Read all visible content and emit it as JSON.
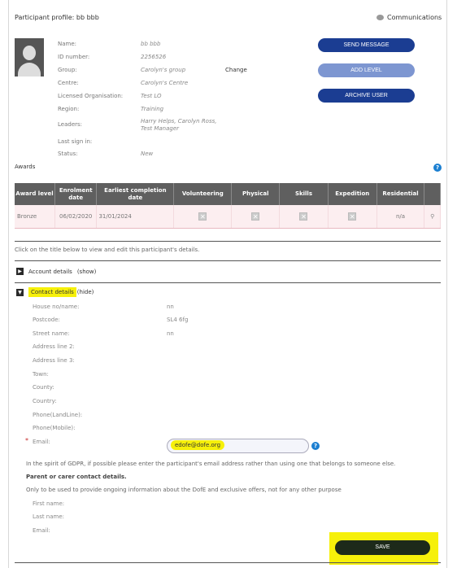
{
  "header": {
    "title": "Participant profile: bb bbb",
    "communications_label": "Communications",
    "communications_icon": "speech-bubble-icon"
  },
  "profile": {
    "fields": [
      {
        "label": "Name:",
        "value": "bb bbb"
      },
      {
        "label": "ID number:",
        "value": "2256526"
      },
      {
        "label": "Group:",
        "value": "Carolyn's group"
      },
      {
        "label": "Centre:",
        "value": "Carolyn's Centre"
      },
      {
        "label": "Licensed Organisation:",
        "value": "Test LO"
      },
      {
        "label": "Region:",
        "value": "Training"
      },
      {
        "label": "Leaders:",
        "value": "Harry Helps, Carolyn Ross, Test Manager"
      },
      {
        "label": "Last sign in:",
        "value": ""
      },
      {
        "label": "Status:",
        "value": "New"
      }
    ],
    "change_label": "Change",
    "avatar_icon": "user-silhouette-icon"
  },
  "actions": {
    "send_message": "SEND MESSAGE",
    "add_level": "ADD LEVEL",
    "archive_user": "ARCHIVE USER"
  },
  "awards": {
    "title": "Awards",
    "help": "?",
    "columns": [
      "Award level",
      "Enrolment date",
      "Earliest completion date",
      "Volunteering",
      "Physical",
      "Skills",
      "Expedition",
      "Residential",
      ""
    ],
    "rows": [
      {
        "level": "Bronze",
        "enrolment": "06/02/2020",
        "earliest": "31/01/2024",
        "residential": "n/a"
      }
    ],
    "search_icon": "magnifier-icon"
  },
  "info_text": "Click on the title below to view and edit this participant's details.",
  "sections": {
    "account": {
      "title": "Account details",
      "toggle": "(show)"
    },
    "contact": {
      "title": "Contact details",
      "toggle": "(hide)"
    }
  },
  "contact": {
    "fields": [
      {
        "label": "House no/name:",
        "value": "nn"
      },
      {
        "label": "Postcode:",
        "value": "SL4 6fg"
      },
      {
        "label": "Street name:",
        "value": "nn"
      },
      {
        "label": "Address line 2:",
        "value": ""
      },
      {
        "label": "Address line 3:",
        "value": ""
      },
      {
        "label": "Town:",
        "value": ""
      },
      {
        "label": "County:",
        "value": ""
      },
      {
        "label": "Country:",
        "value": ""
      },
      {
        "label": "Phone(LandLine):",
        "value": ""
      },
      {
        "label": "Phone(Mobile):",
        "value": ""
      }
    ],
    "email_label": "Email:",
    "email_value": "edofe@dofe.org",
    "required_mark": "*",
    "gdpr_note": "In the spirit of GDPR, if possible please enter the participant's email address rather than using one that belongs to someone else.",
    "parent_title": "Parent or carer contact details.",
    "parent_note": "Only to be used to provide ongoing information about the DofE and exclusive offers, not for any other purpose",
    "parent_fields": [
      "First name:",
      "Last name:",
      "Email:"
    ]
  },
  "footer": {
    "save_label": "SAVE"
  },
  "colors": {
    "primary_button": "#1b3d92",
    "disabled_button": "#7d96d1",
    "table_header": "#5f5f5f",
    "row_background": "#fceef0",
    "highlight": "#f6f00a",
    "save_button": "#1d2a1a"
  }
}
